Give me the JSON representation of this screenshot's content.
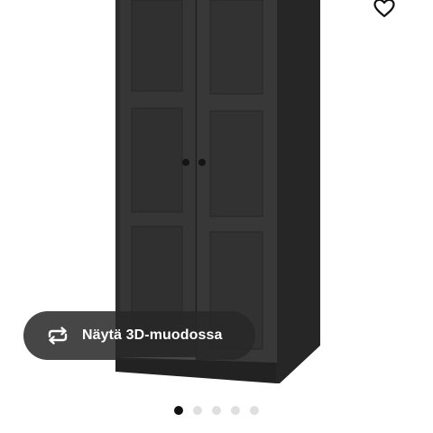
{
  "product": {
    "image_alt": "",
    "favourite_icon": "heart-icon"
  },
  "view_3d": {
    "icon": "rotate-icon",
    "label": "Näytä 3D-muodossa"
  },
  "carousel": {
    "total": 5,
    "active_index": 1
  },
  "colors": {
    "wardrobe": "#353535",
    "overlay": "#282828",
    "dot_active": "#111111",
    "dot_inactive": "#dfdfdf"
  }
}
